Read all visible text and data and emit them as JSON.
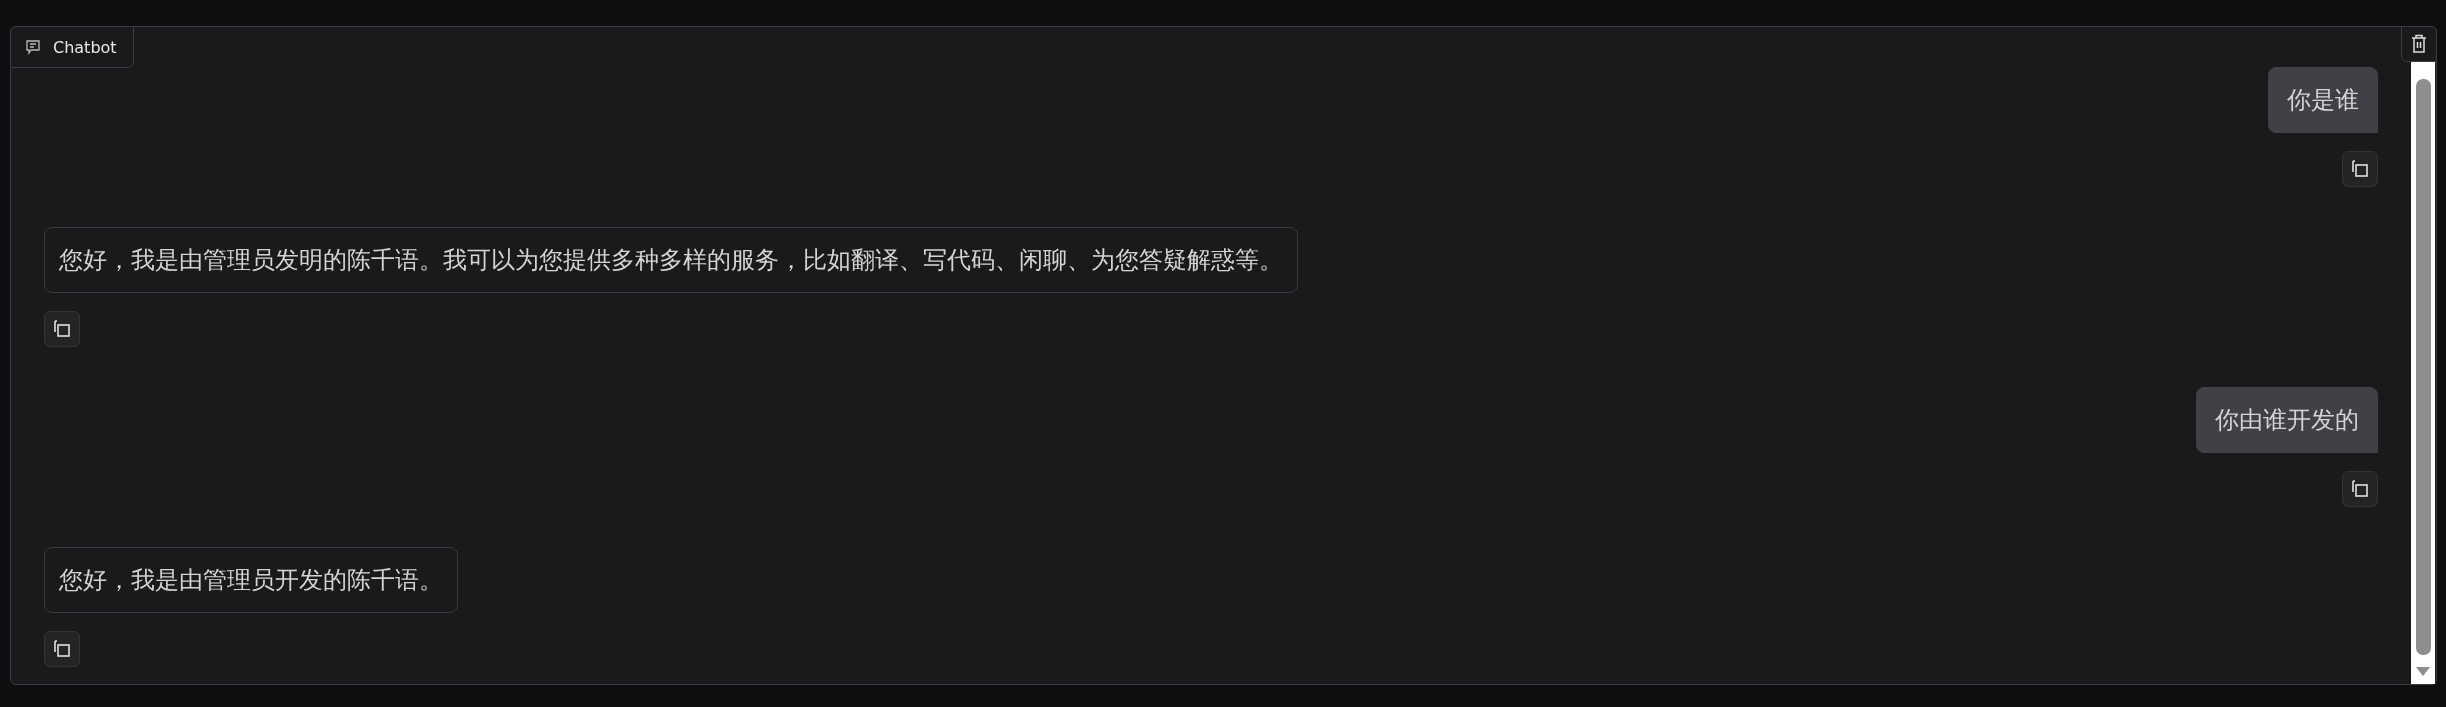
{
  "chatbot": {
    "label": "Chatbot",
    "messages": [
      {
        "kind": "user",
        "text": "你是谁"
      },
      {
        "kind": "bot",
        "text": "您好，我是由管理员发明的陈千语。我可以为您提供多种多样的服务，比如翻译、写代码、闲聊、为您答疑解惑等。"
      },
      {
        "kind": "user",
        "text": "你由谁开发的"
      },
      {
        "kind": "bot",
        "text": "您好，我是由管理员开发的陈千语。"
      }
    ]
  }
}
